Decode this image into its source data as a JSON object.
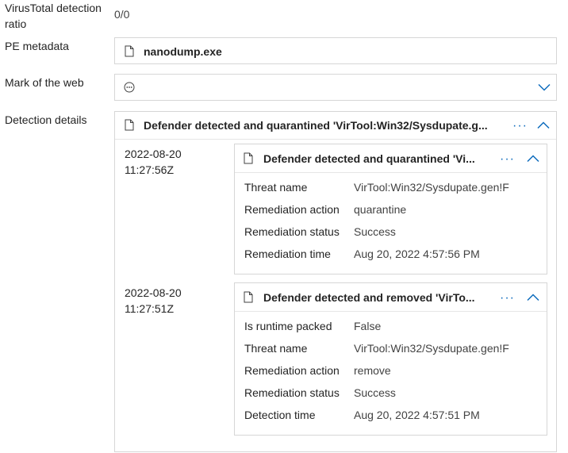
{
  "fields": {
    "virustotal_label": "VirusTotal detection ratio",
    "virustotal_value": "0/0",
    "pe_label": "PE metadata",
    "pe_value": "nanodump.exe",
    "motw_label": "Mark of the web",
    "detection_label": "Detection details"
  },
  "detection_panel": {
    "title": "Defender detected and quarantined 'VirTool:Win32/Sysdupate.g...",
    "more_icon": "ellipsis-icon",
    "collapse_icon": "chevron-up-icon"
  },
  "events": [
    {
      "timestamp_date": "2022-08-20",
      "timestamp_time": "11:27:56Z",
      "title": "Defender detected and quarantined 'Vi...",
      "rows": [
        {
          "label": "Threat name",
          "value": "VirTool:Win32/Sysdupate.gen!F"
        },
        {
          "label": "Remediation action",
          "value": "quarantine"
        },
        {
          "label": "Remediation status",
          "value": "Success"
        },
        {
          "label": "Remediation time",
          "value": "Aug 20, 2022 4:57:56 PM"
        }
      ]
    },
    {
      "timestamp_date": "2022-08-20",
      "timestamp_time": "11:27:51Z",
      "title": "Defender detected and removed 'VirTo...",
      "rows": [
        {
          "label": "Is runtime packed",
          "value": "False"
        },
        {
          "label": "Threat name",
          "value": "VirTool:Win32/Sysdupate.gen!F"
        },
        {
          "label": "Remediation action",
          "value": "remove"
        },
        {
          "label": "Remediation status",
          "value": "Success"
        },
        {
          "label": "Detection time",
          "value": "Aug 20, 2022 4:57:51 PM"
        }
      ]
    }
  ],
  "colors": {
    "accent": "#0f6cbd",
    "border": "#d6d6d6"
  }
}
